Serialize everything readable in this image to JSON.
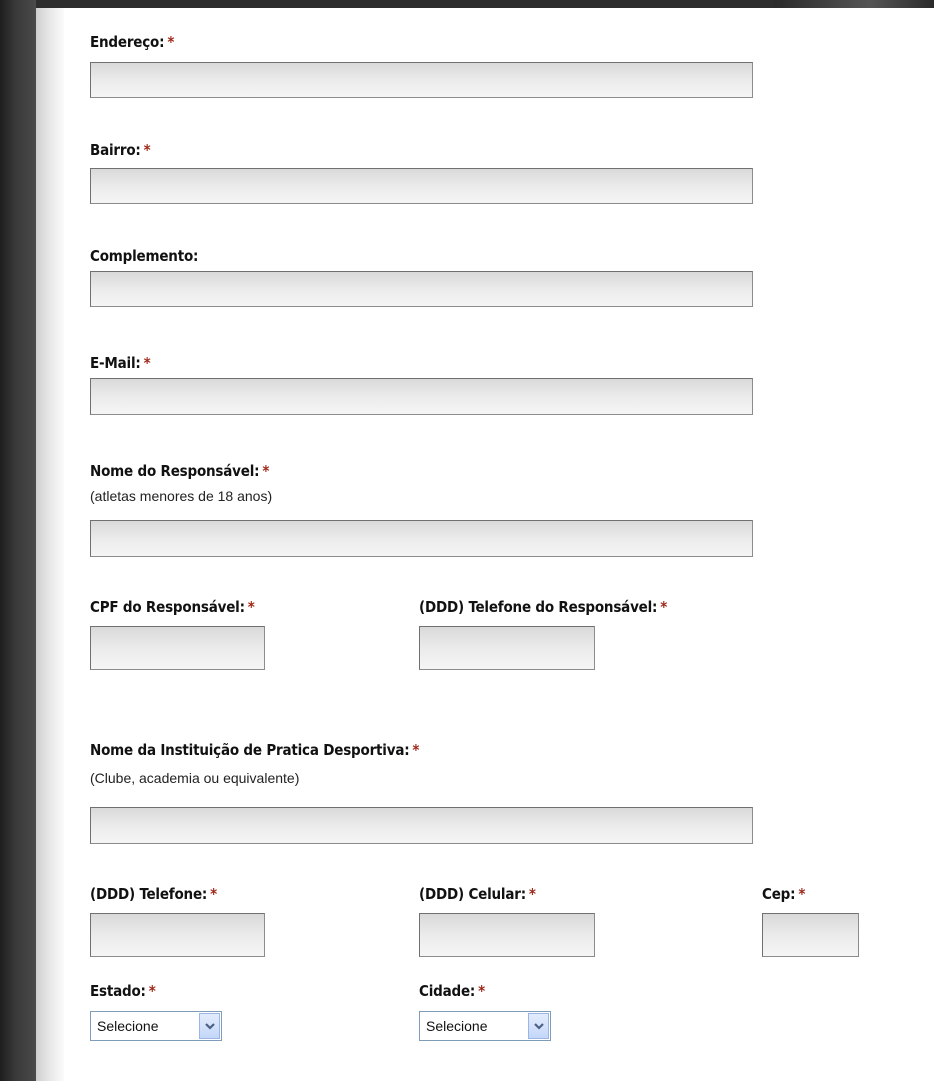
{
  "required_marker": "*",
  "icons": {
    "dropdown": "chevron-down-icon"
  },
  "colors": {
    "required": "#a0281a",
    "field_bg": "#e6e6e6",
    "select_border": "#7f9db9"
  },
  "form": {
    "endereco": {
      "label": "Endereço:",
      "value": ""
    },
    "bairro": {
      "label": "Bairro:",
      "value": ""
    },
    "complemento": {
      "label": "Complemento:",
      "value": ""
    },
    "email": {
      "label": "E-Mail:",
      "value": ""
    },
    "nome_responsavel": {
      "label": "Nome do Responsável:",
      "hint": "(atletas menores de 18 anos)",
      "value": ""
    },
    "cpf_responsavel": {
      "label": "CPF do Responsável:",
      "value": ""
    },
    "telefone_responsavel": {
      "label": "(DDD) Telefone do Responsável:",
      "value": ""
    },
    "instituicao": {
      "label": "Nome da Instituição de Pratica Desportiva:",
      "hint": "(Clube, academia ou equivalente)",
      "value": ""
    },
    "telefone": {
      "label": "(DDD) Telefone:",
      "value": ""
    },
    "celular": {
      "label": "(DDD) Celular:",
      "value": ""
    },
    "cep": {
      "label": "Cep:",
      "value": ""
    },
    "estado": {
      "label": "Estado:",
      "selected": "Selecione"
    },
    "cidade": {
      "label": "Cidade:",
      "selected": "Selecione"
    }
  }
}
